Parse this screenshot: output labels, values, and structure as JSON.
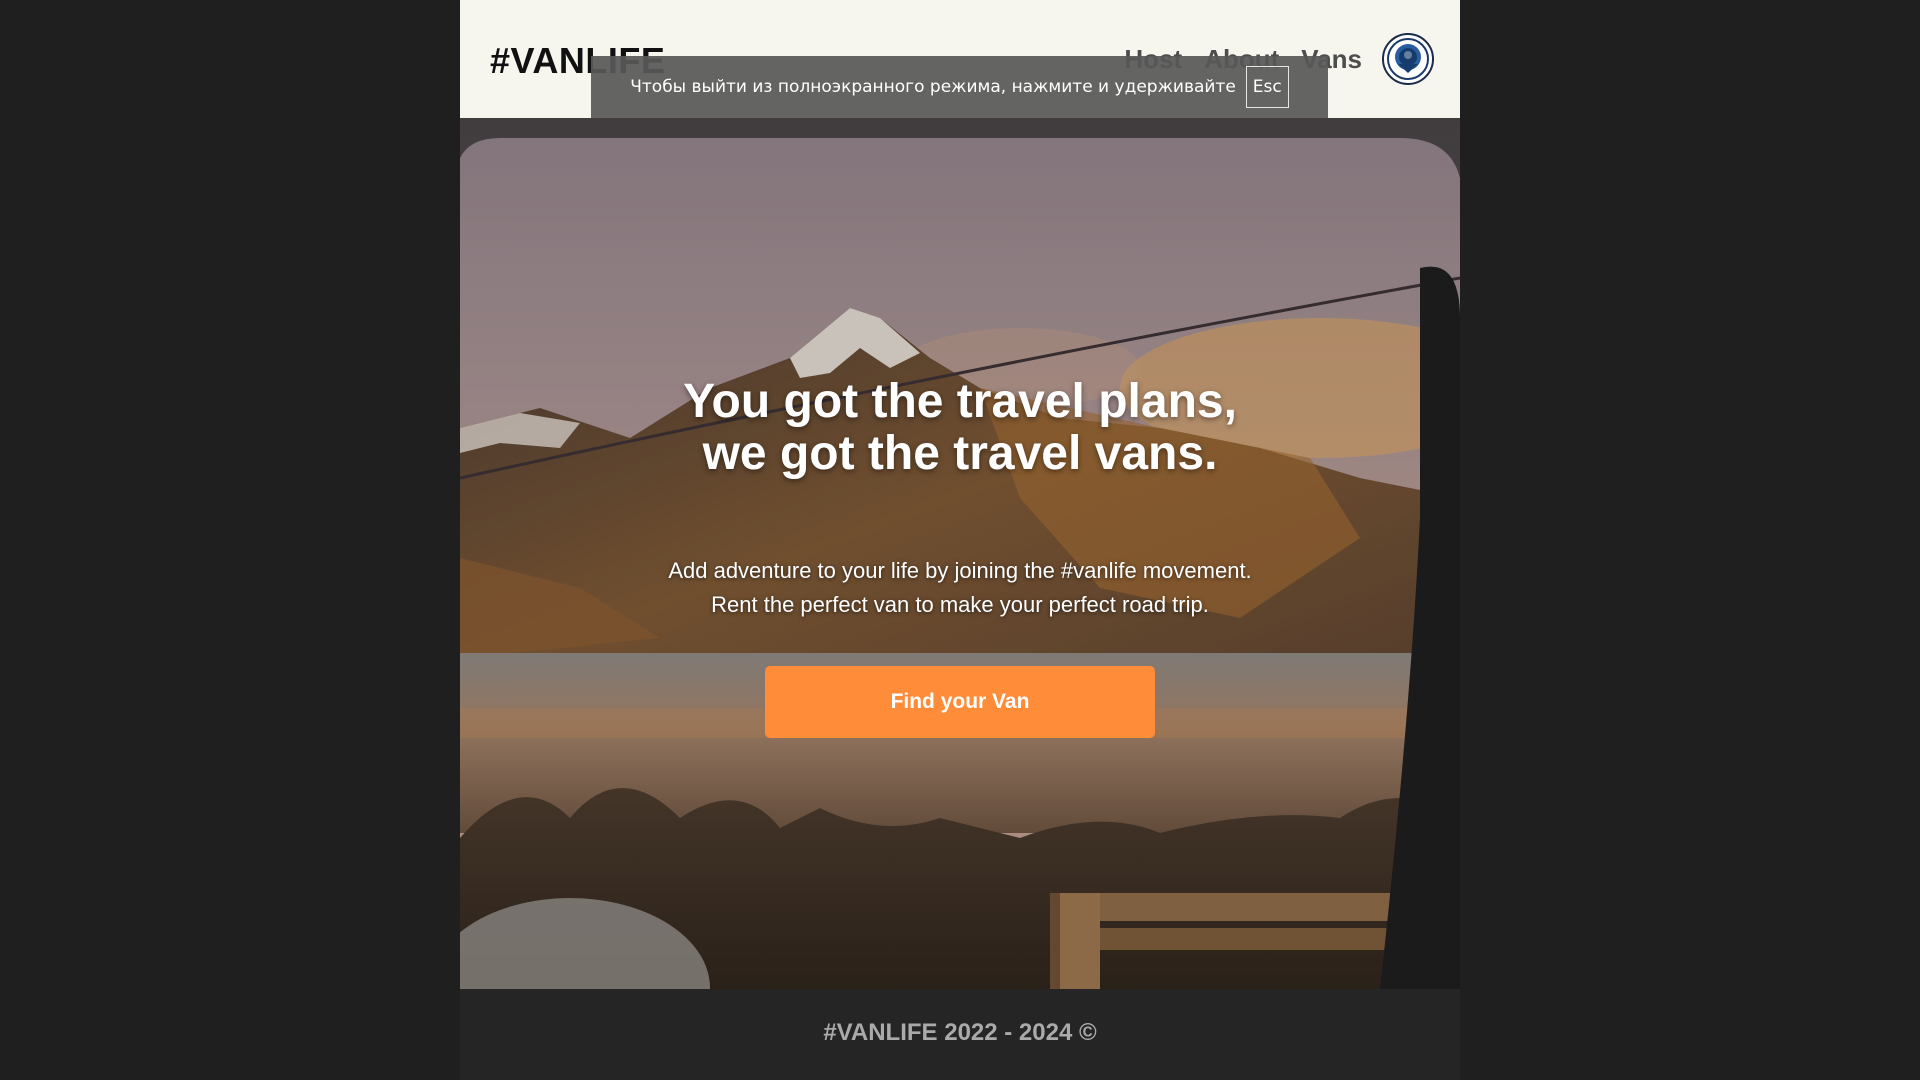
{
  "header": {
    "logo": "#VANLIFE",
    "nav": [
      "Host",
      "About",
      "Vans"
    ],
    "avatar_icon": "user-avatar-icon"
  },
  "hero": {
    "title_line1": "You got the travel plans,",
    "title_line2": "we got the travel vans.",
    "subtitle_line1": "Add adventure to your life by joining the #vanlife movement.",
    "subtitle_line2": "Rent the perfect van to make your perfect road trip.",
    "cta_label": "Find your Van",
    "cta_color": "#ff8c38"
  },
  "footer": {
    "text": "#VANLIFE 2022 - 2024 ©"
  },
  "fullscreen_notice": {
    "text": "Чтобы выйти из полноэкранного режима, нажмите и удерживайте",
    "key": "Esc"
  }
}
